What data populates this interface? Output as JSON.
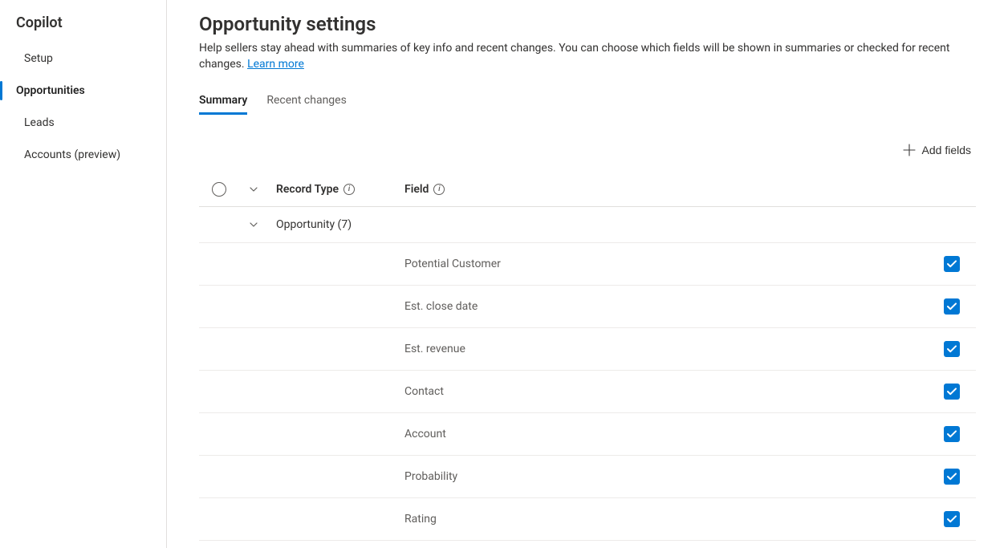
{
  "sidebar": {
    "title": "Copilot",
    "items": [
      {
        "label": "Setup",
        "active": false
      },
      {
        "label": "Opportunities",
        "active": true
      },
      {
        "label": "Leads",
        "active": false
      },
      {
        "label": "Accounts (preview)",
        "active": false
      }
    ]
  },
  "page": {
    "title": "Opportunity settings",
    "desc_prefix": "Help sellers stay ahead with summaries of key info and recent changes. You can choose which fields will be shown in summaries or checked for recent changes. ",
    "learn_more": "Learn more"
  },
  "tabs": [
    {
      "label": "Summary",
      "active": true
    },
    {
      "label": "Recent changes",
      "active": false
    }
  ],
  "toolbar": {
    "add_fields": "Add fields"
  },
  "grid": {
    "col_record_type": "Record Type",
    "col_field": "Field",
    "group_label": "Opportunity (7)",
    "fields": [
      {
        "name": "Potential Customer",
        "checked": true
      },
      {
        "name": "Est. close date",
        "checked": true
      },
      {
        "name": "Est. revenue",
        "checked": true
      },
      {
        "name": "Contact",
        "checked": true
      },
      {
        "name": "Account",
        "checked": true
      },
      {
        "name": "Probability",
        "checked": true
      },
      {
        "name": "Rating",
        "checked": true
      }
    ]
  }
}
